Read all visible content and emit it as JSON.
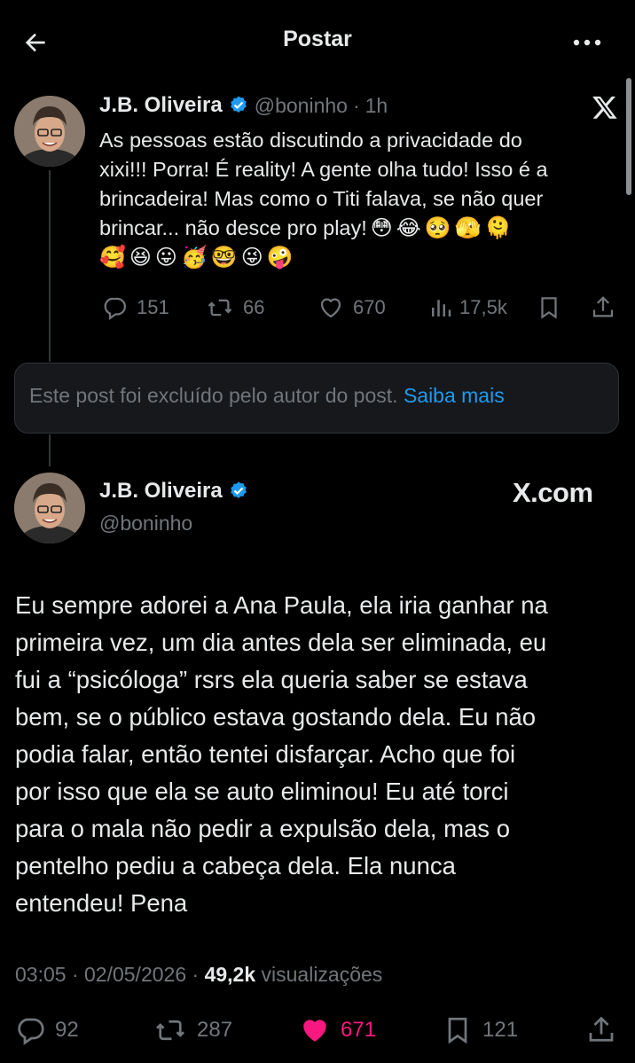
{
  "header": {
    "title": "Postar"
  },
  "quoted_post": {
    "name": "J.B. Oliveira",
    "handle": "@boninho",
    "separator": "·",
    "time": "1h",
    "text_lines": [
      "As pessoas estão discutindo a privacidade do",
      "xixi!!! Porra! É reality! A gente olha tudo! Isso é a",
      "brincadeira! Mas como o Titi falava, se não quer",
      "brincar... não desce pro play!"
    ],
    "emojis_line1": [
      "😳",
      "😂",
      "🥺",
      "🫣",
      "🫠"
    ],
    "emojis_line2": [
      "🥰",
      "😆",
      "😛",
      "🥳",
      "🤓",
      "😜",
      "🤪"
    ],
    "actions": {
      "replies": "151",
      "reposts": "66",
      "likes": "670",
      "views": "17,5k"
    }
  },
  "deleted_notice": {
    "text": "Este post foi excluído pelo autor do post.",
    "link": "Saiba mais"
  },
  "main_post": {
    "name": "J.B. Oliveira",
    "handle": "@boninho",
    "watermark": "X.com",
    "text_lines": [
      "Eu sempre adorei a Ana Paula, ela iria ganhar na",
      "primeira vez, um dia antes dela ser eliminada, eu",
      "fui a “psicóloga” rsrs ela queria saber se estava",
      "bem, se o público estava gostando dela. Eu não",
      "podia falar, então tentei disfarçar. Acho que foi",
      "por isso que ela se auto eliminou! Eu até torci",
      "para o mala não pedir a expulsão dela, mas o",
      "pentelho pediu a cabeça dela. Ela nunca",
      "entendeu! Pena"
    ],
    "time": "03:05 · 02/05/2026",
    "separator": "·",
    "views_count": "49,2k",
    "views_label": "visualizações",
    "actions": {
      "replies": "92",
      "reposts": "287",
      "likes": "671",
      "bookmarks": "121"
    }
  },
  "colors": {
    "background": "#000000",
    "text": "#e7e9ea",
    "muted": "#71767b",
    "link": "#1d9bf0",
    "like": "#f91880"
  },
  "icons": [
    "back-arrow-icon",
    "more-icon",
    "x-logo-icon",
    "verified-badge-icon",
    "reply-icon",
    "repost-icon",
    "like-icon",
    "views-icon",
    "bookmark-icon",
    "share-icon"
  ]
}
